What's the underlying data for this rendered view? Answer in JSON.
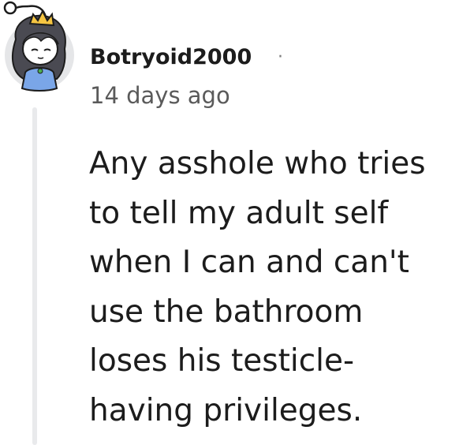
{
  "comment": {
    "author": "Botryoid2000",
    "separator": "·",
    "timestamp": "14 days ago",
    "body": "Any asshole who tries\nto tell my adult self\nwhen I can and can't\nuse the bathroom\nloses his testicle-\nhaving privileges.",
    "avatar_icon": "snoo-avatar-icon",
    "colors": {
      "text": "#1c1c1c",
      "meta": "#5a5a5a",
      "thread_line": "#e9eaec",
      "avatar_bg": "#e5e6e8",
      "crown": "#f5c542",
      "dress": "#7aa6e8"
    }
  }
}
